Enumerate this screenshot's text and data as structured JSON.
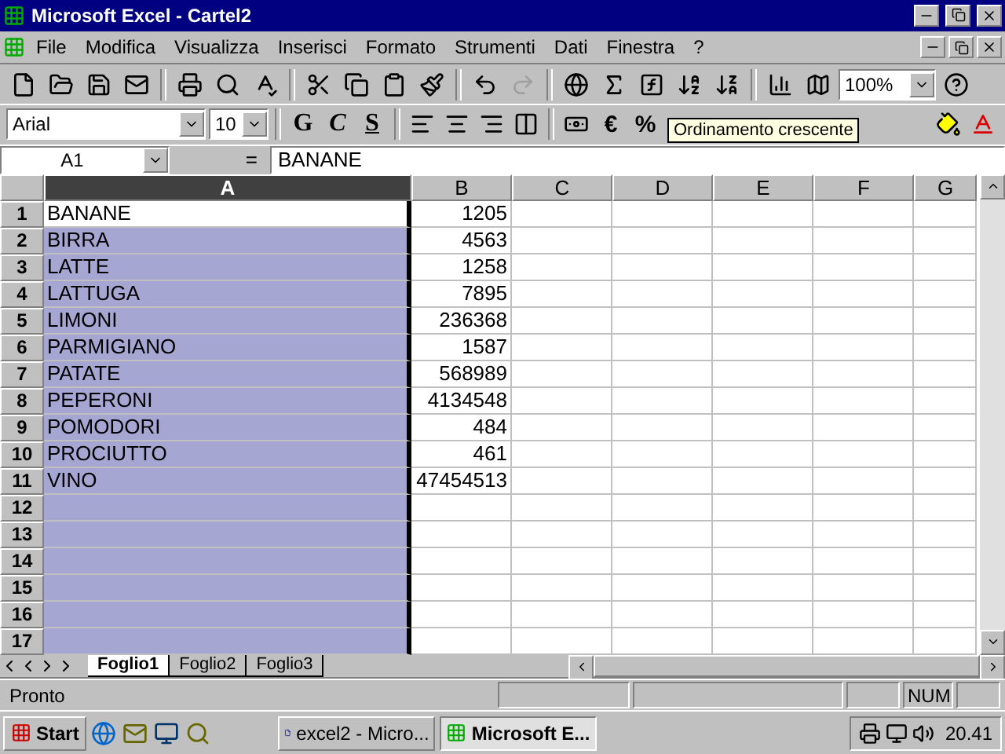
{
  "window": {
    "title": "Microsoft Excel - Cartel2"
  },
  "menu": [
    "File",
    "Modifica",
    "Visualizza",
    "Inserisci",
    "Formato",
    "Strumenti",
    "Dati",
    "Finestra",
    "?"
  ],
  "standard_toolbar": [
    [
      {
        "kind": "new",
        "disabled": false
      },
      {
        "kind": "open",
        "disabled": false
      },
      {
        "kind": "save",
        "disabled": false
      },
      {
        "kind": "mail",
        "disabled": false
      }
    ],
    [
      {
        "kind": "print",
        "disabled": false
      },
      {
        "kind": "preview",
        "disabled": false
      },
      {
        "kind": "spell",
        "disabled": false
      }
    ],
    [
      {
        "kind": "cut",
        "disabled": false
      },
      {
        "kind": "copy",
        "disabled": false
      },
      {
        "kind": "paste",
        "disabled": false
      },
      {
        "kind": "painter",
        "disabled": false
      }
    ],
    [
      {
        "kind": "undo",
        "disabled": false
      },
      {
        "kind": "redo",
        "disabled": true
      }
    ],
    [
      {
        "kind": "web",
        "disabled": false
      },
      {
        "kind": "sum",
        "disabled": false
      },
      {
        "kind": "function",
        "disabled": false
      },
      {
        "kind": "sortasc",
        "disabled": false
      },
      {
        "kind": "sortdesc",
        "disabled": false
      }
    ],
    [
      {
        "kind": "chart",
        "disabled": false
      },
      {
        "kind": "map",
        "disabled": false
      }
    ]
  ],
  "zoom": "100%",
  "format_toolbar": {
    "font": "Arial",
    "size": "10",
    "buttons": [
      "G",
      "C",
      "S"
    ],
    "symbols": [
      "€",
      "%"
    ]
  },
  "tooltip": "Ordinamento crescente",
  "formula_bar": {
    "name_box": "A1",
    "equals": "=",
    "value": "BANANE"
  },
  "columns": [
    {
      "label": "A",
      "selected": true
    },
    {
      "label": "B",
      "selected": false
    },
    {
      "label": "C",
      "selected": false
    },
    {
      "label": "D",
      "selected": false
    },
    {
      "label": "E",
      "selected": false
    },
    {
      "label": "F",
      "selected": false
    },
    {
      "label": "G",
      "selected": false
    }
  ],
  "rows": [
    {
      "header": "1",
      "active": true,
      "cells": [
        "BANANE",
        "1205"
      ]
    },
    {
      "header": "2",
      "active": false,
      "cells": [
        "BIRRA",
        "4563"
      ]
    },
    {
      "header": "3",
      "active": false,
      "cells": [
        "LATTE",
        "1258"
      ]
    },
    {
      "header": "4",
      "active": false,
      "cells": [
        "LATTUGA",
        "7895"
      ]
    },
    {
      "header": "5",
      "active": false,
      "cells": [
        "LIMONI",
        "236368"
      ]
    },
    {
      "header": "6",
      "active": false,
      "cells": [
        "PARMIGIANO",
        "1587"
      ]
    },
    {
      "header": "7",
      "active": false,
      "cells": [
        "PATATE",
        "568989"
      ]
    },
    {
      "header": "8",
      "active": false,
      "cells": [
        "PEPERONI",
        "4134548"
      ]
    },
    {
      "header": "9",
      "active": false,
      "cells": [
        "POMODORI",
        "484"
      ]
    },
    {
      "header": "10",
      "active": false,
      "cells": [
        "PROCIUTTO",
        "461"
      ]
    },
    {
      "header": "11",
      "active": false,
      "cells": [
        "VINO",
        "47454513"
      ]
    },
    {
      "header": "12",
      "active": false
    },
    {
      "header": "13",
      "active": false
    },
    {
      "header": "14",
      "active": false
    },
    {
      "header": "15",
      "active": false
    },
    {
      "header": "16",
      "active": false
    },
    {
      "header": "17",
      "active": false
    }
  ],
  "sheet_tabs": [
    {
      "label": "Foglio1",
      "selected": true
    },
    {
      "label": "Foglio2",
      "selected": false
    },
    {
      "label": "Foglio3",
      "selected": false
    }
  ],
  "status_bar": {
    "text": "Pronto",
    "indicator": "NUM"
  },
  "taskbar": {
    "start": "Start",
    "buttons": [
      {
        "label": "excel2 - Micro...",
        "kind": "word",
        "selected": false
      },
      {
        "label": "Microsoft E...",
        "kind": "excel",
        "selected": true
      }
    ],
    "clock": "20.41"
  }
}
